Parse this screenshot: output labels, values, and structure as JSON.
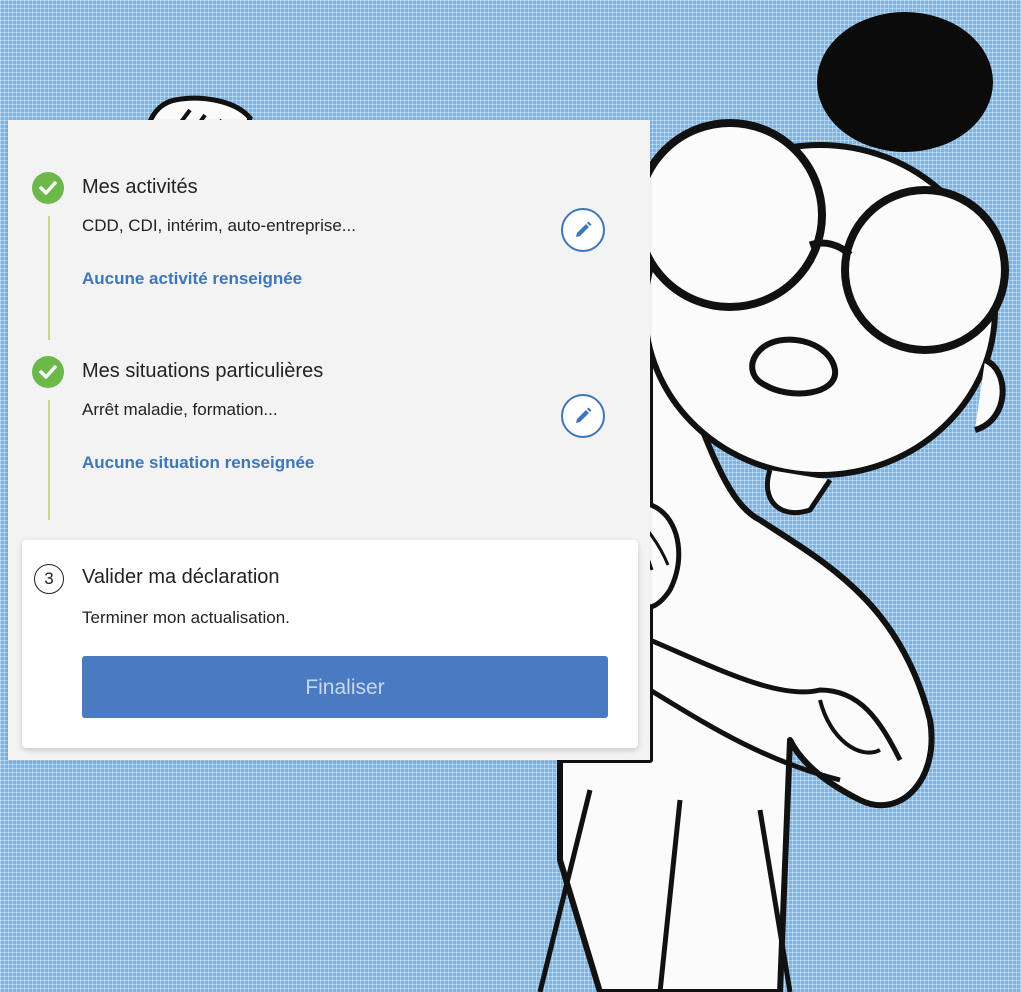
{
  "steps": [
    {
      "title": "Mes activités",
      "subtitle": "CDD, CDI, intérim, auto-entreprise...",
      "status": "Aucune activité renseignée",
      "icon": "check-circle-icon",
      "action_icon": "pencil-icon"
    },
    {
      "title": "Mes situations particulières",
      "subtitle": "Arrêt maladie, formation...",
      "status": "Aucune situation renseignée",
      "icon": "check-circle-icon",
      "action_icon": "pencil-icon"
    }
  ],
  "validate": {
    "number": "3",
    "title": "Valider ma déclaration",
    "subtitle": "Terminer mon actualisation.",
    "button_label": "Finaliser"
  },
  "colors": {
    "background": "#7fb3e1",
    "check": "#6cb84a",
    "link": "#3d76b9",
    "button": "#4a7bc2",
    "button_text": "#c9d7ee",
    "timeline": "#c5d48f"
  }
}
